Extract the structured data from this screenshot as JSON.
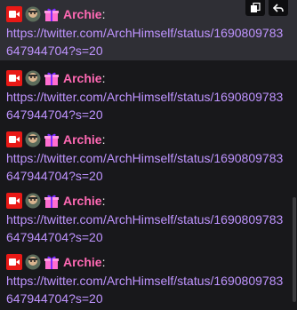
{
  "chat": {
    "colors": {
      "background": "#18181b",
      "hover_background": "#2f2f35",
      "username": "#ff69b4",
      "link": "#bf94ff",
      "text": "#efeff1"
    },
    "hover_actions": [
      {
        "icon": "copy-icon"
      },
      {
        "icon": "reply-icon"
      }
    ],
    "messages": [
      {
        "badges": [
          "video-badge-icon",
          "avatar-badge-icon",
          "gift-badge-icon"
        ],
        "username": "Archie",
        "colon": ":",
        "text": "https://twitter.com/ArchHimself/status/1690809783647944704?s=20"
      },
      {
        "badges": [
          "video-badge-icon",
          "avatar-badge-icon",
          "gift-badge-icon"
        ],
        "username": "Archie",
        "colon": ":",
        "text": "https://twitter.com/ArchHimself/status/1690809783647944704?s=20"
      },
      {
        "badges": [
          "video-badge-icon",
          "avatar-badge-icon",
          "gift-badge-icon"
        ],
        "username": "Archie",
        "colon": ":",
        "text": "https://twitter.com/ArchHimself/status/1690809783647944704?s=20"
      },
      {
        "badges": [
          "video-badge-icon",
          "avatar-badge-icon",
          "gift-badge-icon"
        ],
        "username": "Archie",
        "colon": ":",
        "text": "https://twitter.com/ArchHimself/status/1690809783647944704?s=20"
      },
      {
        "badges": [
          "video-badge-icon",
          "avatar-badge-icon",
          "gift-badge-icon"
        ],
        "username": "Archie",
        "colon": ":",
        "text": "https://twitter.com/ArchHimself/status/1690809783647944704?s=20"
      }
    ]
  }
}
